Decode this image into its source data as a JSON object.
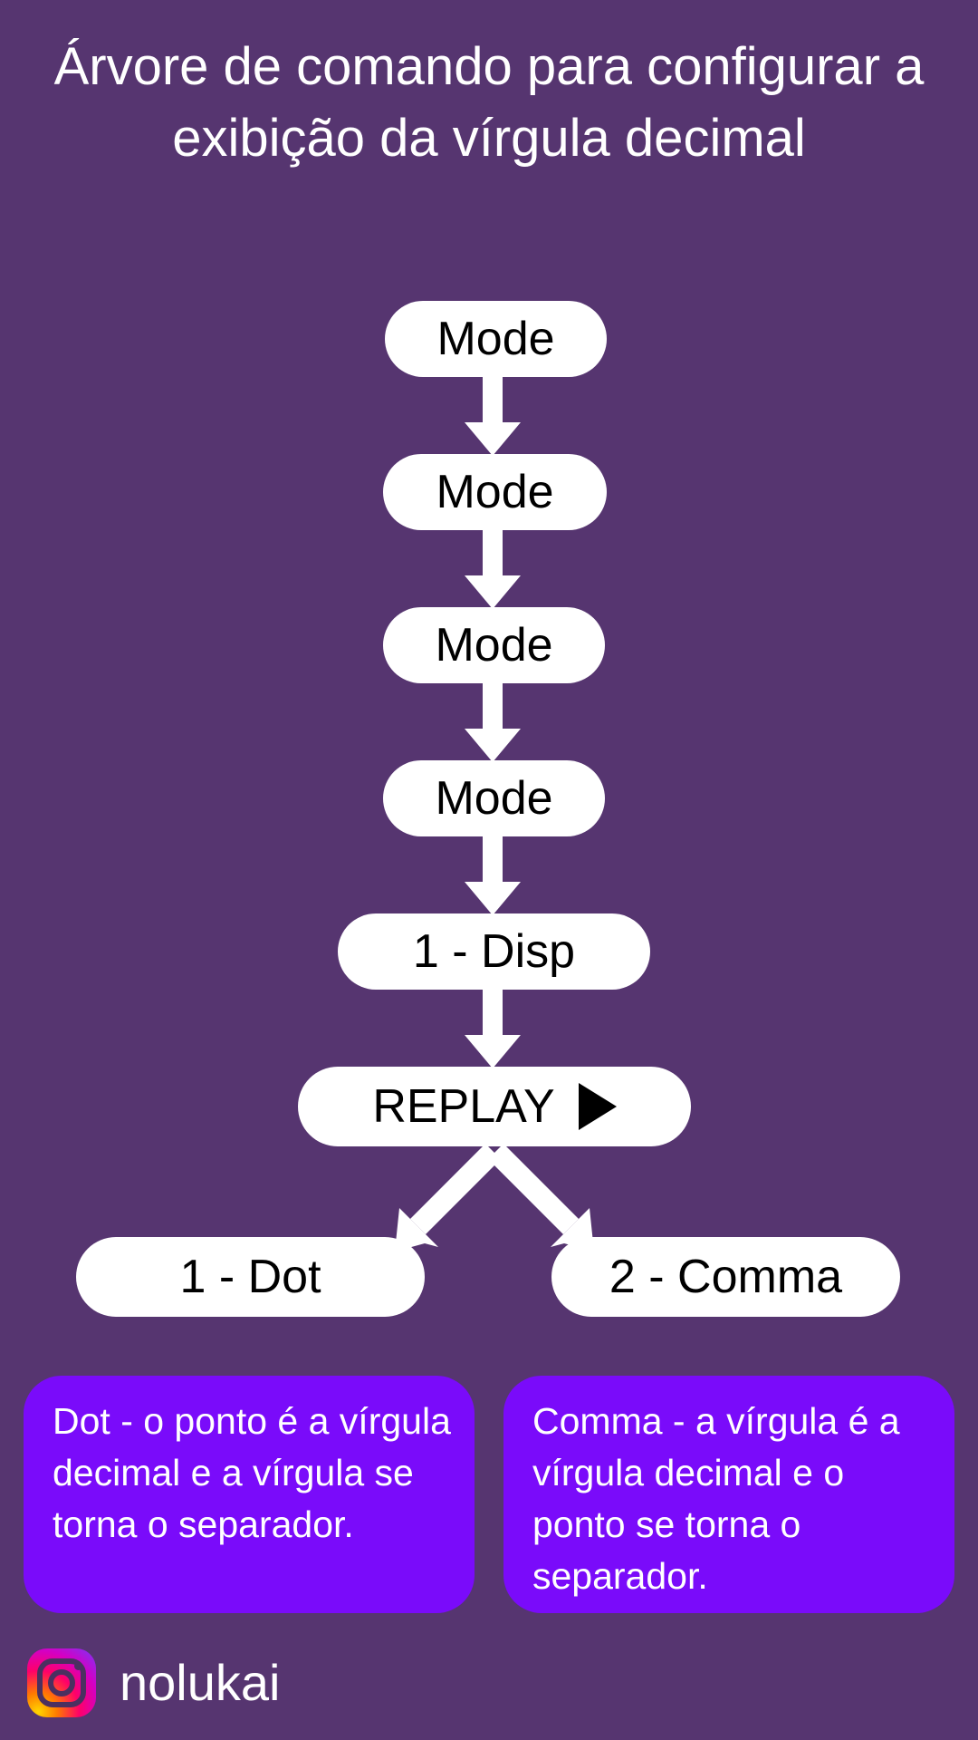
{
  "page": {
    "background_color": "#563570",
    "title": "Árvore de comando para configurar a exibição da vírgula decimal"
  },
  "flow": {
    "nodes": [
      {
        "id": "mode-1",
        "label": "Mode"
      },
      {
        "id": "mode-2",
        "label": "Mode"
      },
      {
        "id": "mode-3",
        "label": "Mode"
      },
      {
        "id": "mode-4",
        "label": "Mode"
      },
      {
        "id": "disp",
        "label": "1 - Disp"
      },
      {
        "id": "replay",
        "label": "REPLAY",
        "icon": "play-icon"
      },
      {
        "id": "dot",
        "label": "1 - Dot"
      },
      {
        "id": "comma",
        "label": "2 - Comma"
      }
    ],
    "node_fill_color": "#ffffff",
    "node_text_color": "#000000",
    "arrow_color": "#ffffff",
    "edges": [
      {
        "from": "mode-1",
        "to": "mode-2",
        "shape": "straight-down"
      },
      {
        "from": "mode-2",
        "to": "mode-3",
        "shape": "straight-down"
      },
      {
        "from": "mode-3",
        "to": "mode-4",
        "shape": "straight-down"
      },
      {
        "from": "mode-4",
        "to": "disp",
        "shape": "straight-down"
      },
      {
        "from": "disp",
        "to": "replay",
        "shape": "straight-down"
      },
      {
        "from": "replay",
        "to": "dot",
        "shape": "diagonal-left"
      },
      {
        "from": "replay",
        "to": "comma",
        "shape": "diagonal-right"
      }
    ]
  },
  "explanations": {
    "card_color": "#7a0bfa",
    "card_text_color": "#ffffff",
    "left": "Dot - o ponto é a vírgula decimal e a vírgula se torna o separador.",
    "right": "Comma - a vírgula é a vírgula decimal e o ponto se torna o separador."
  },
  "footer": {
    "icon": "instagram-icon",
    "handle": "nolukai"
  }
}
